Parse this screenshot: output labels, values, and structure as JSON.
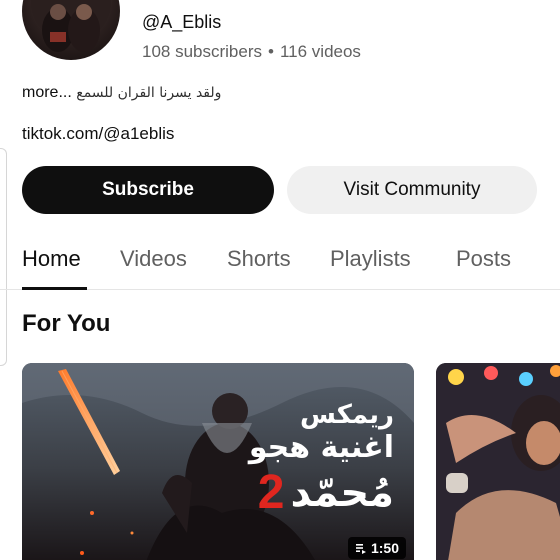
{
  "channel": {
    "handle": "@A_Eblis",
    "subscribers": "108 subscribers",
    "separator": "•",
    "videos": "116 videos",
    "description_arabic": "ولقد يسرنا القران للسمع",
    "description_more": "more...",
    "link": "tiktok.com/@a1eblis"
  },
  "buttons": {
    "subscribe": "Subscribe",
    "visit_community": "Visit Community"
  },
  "tabs": [
    {
      "label": "Home",
      "active": true
    },
    {
      "label": "Videos",
      "active": false
    },
    {
      "label": "Shorts",
      "active": false
    },
    {
      "label": "Playlists",
      "active": false
    },
    {
      "label": "Posts",
      "active": false
    }
  ],
  "section": {
    "title": "For You"
  },
  "videos": [
    {
      "overlay_title_line1": "ريمكس",
      "overlay_title_line2": "اغنية هجو",
      "overlay_title_line3": "مُحمّد",
      "overlay_number": "2",
      "duration": "1:50"
    },
    {}
  ],
  "colors": {
    "subscribe_bg": "#0f0f0f",
    "community_bg": "#f0f0f0",
    "muted_text": "#606060",
    "accent_red": "#e0261f"
  }
}
